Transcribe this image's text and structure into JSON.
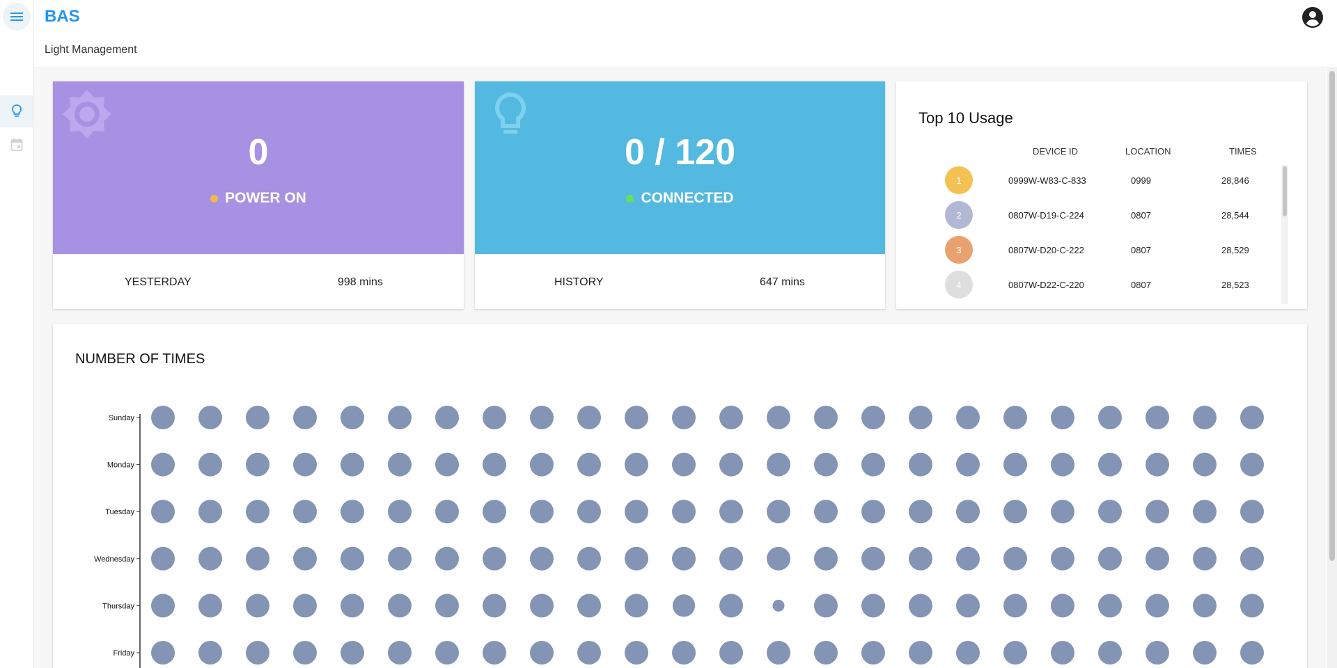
{
  "header": {
    "brand": "BAS",
    "page_title": "Light Management"
  },
  "sidebar": {
    "items": [
      {
        "icon": "lightbulb-icon",
        "active": true
      },
      {
        "icon": "calendar-icon",
        "active": false
      }
    ]
  },
  "power_card": {
    "value": "0",
    "status": "POWER ON",
    "status_color": "#f6b94d",
    "bg_color": "#a791e3",
    "footer_label": "YESTERDAY",
    "footer_value": "998 mins"
  },
  "connection_card": {
    "value": "0 / 120",
    "status": "CONNECTED",
    "status_color": "#66e05c",
    "bg_color": "#54b9e1",
    "footer_label": "HISTORY",
    "footer_value": "647 mins"
  },
  "top_usage": {
    "title": "Top 10 Usage",
    "columns": [
      "DEVICE ID",
      "LOCATION",
      "TIMES"
    ],
    "rows": [
      {
        "rank": "1",
        "color": "#f4c152",
        "device_id": "0999W-W83-C-833",
        "location": "0999",
        "times": "28,846"
      },
      {
        "rank": "2",
        "color": "#b2b8d4",
        "device_id": "0807W-D19-C-224",
        "location": "0807",
        "times": "28,544"
      },
      {
        "rank": "3",
        "color": "#e9a26f",
        "device_id": "0807W-D20-C-222",
        "location": "0807",
        "times": "28,529"
      },
      {
        "rank": "4",
        "color": "#dedede",
        "device_id": "0807W-D22-C-220",
        "location": "0807",
        "times": "28,523"
      }
    ]
  },
  "chart_data": {
    "type": "scatter",
    "title": "NUMBER OF TIMES",
    "y_categories": [
      "Sunday",
      "Monday",
      "Tuesday",
      "Wednesday",
      "Thursday",
      "Friday"
    ],
    "columns": 24,
    "dot_color": "#8394b5",
    "values": [
      [
        1,
        1,
        1,
        1,
        1,
        1,
        1,
        1,
        1,
        1,
        1,
        1,
        1,
        1,
        1,
        1,
        1,
        1,
        1,
        1,
        1,
        1,
        1,
        1
      ],
      [
        1,
        1,
        1,
        1,
        1,
        1,
        1,
        1,
        1,
        1,
        1,
        1,
        1,
        1,
        1,
        1,
        1,
        1,
        1,
        1,
        1,
        1,
        1,
        1
      ],
      [
        1,
        1,
        1,
        1,
        1,
        1,
        1,
        1,
        1,
        1,
        1,
        1,
        1,
        1,
        1,
        1,
        1,
        1,
        1,
        1,
        1,
        1,
        1,
        1
      ],
      [
        1,
        1,
        1,
        1,
        1,
        1,
        1,
        1,
        1,
        1,
        1,
        1,
        1,
        1,
        1,
        1,
        1,
        1,
        1,
        1,
        1,
        1,
        1,
        1
      ],
      [
        1,
        1,
        1,
        1,
        1,
        1,
        1,
        1,
        1,
        1,
        1,
        0.95,
        1,
        0.5,
        1,
        1,
        1,
        1,
        1,
        1,
        1,
        1,
        1,
        1
      ],
      [
        1,
        1,
        1,
        1,
        1,
        1,
        1,
        1,
        1,
        1,
        1,
        1,
        1,
        1,
        1,
        1,
        1,
        1,
        1,
        1,
        1,
        1,
        1,
        1
      ]
    ]
  }
}
